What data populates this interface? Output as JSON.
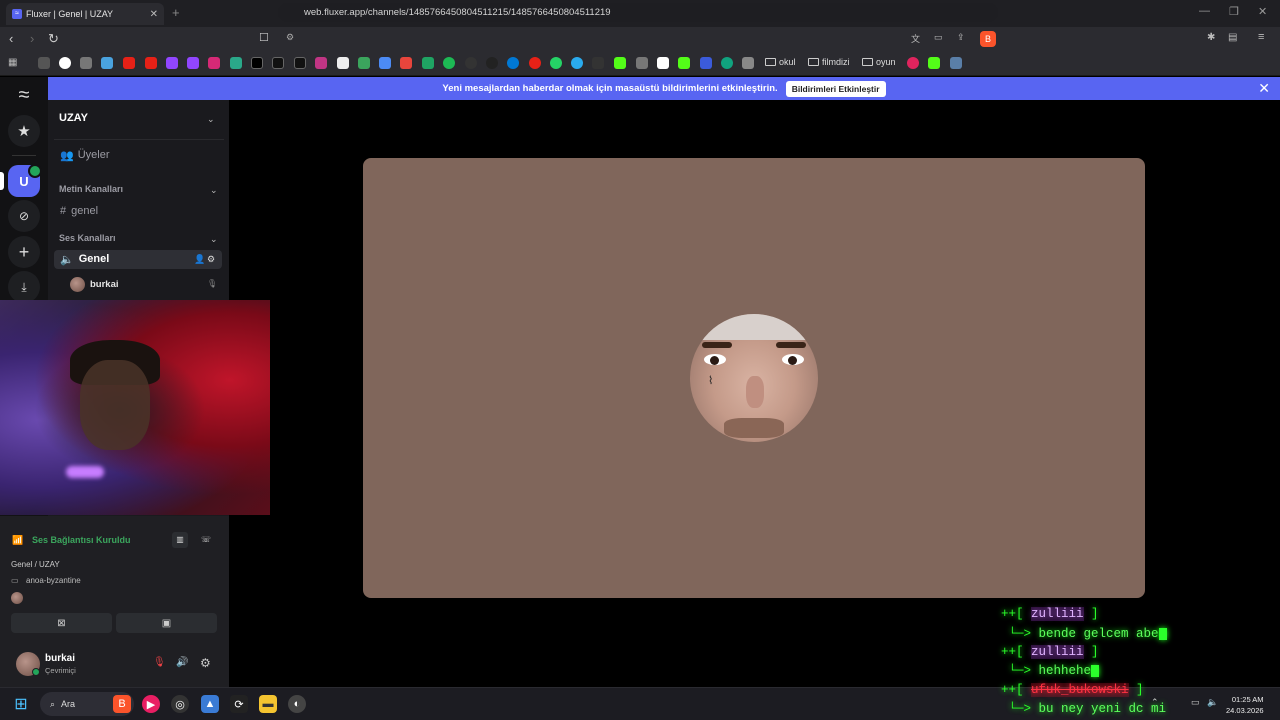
{
  "browser": {
    "tab_title": "Fluxer | Genel | UZAY",
    "url": "web.fluxer.app/channels/1485766450804511215/1485766450804511219",
    "bookmark_folders": [
      "okul",
      "filmdizi",
      "oyun"
    ]
  },
  "banner": {
    "message": "Yeni mesajlardan haberdar olmak için masaüstü bildirimlerini etkinleştirin.",
    "cta_label": "Bildirimleri Etkinleştir"
  },
  "rail": {
    "server_initial": "U"
  },
  "sidebar": {
    "server_name": "UZAY",
    "members_label": "Üyeler",
    "text_category": "Metin Kanalları",
    "text_channel": "genel",
    "voice_category": "Ses Kanalları",
    "voice_channel": "Genel",
    "voice_member": "burkai"
  },
  "voice_panel": {
    "status": "Ses Bağlantısı Kuruldu",
    "channel_path": "Genel / UZAY",
    "activity": "anoa-byzantine"
  },
  "user_panel": {
    "username": "burkai",
    "status": "Çevrimiçi"
  },
  "chat_overlay": [
    {
      "user": "zulliii",
      "message": "bende gelcem abe",
      "style": "purple"
    },
    {
      "user": "zulliii",
      "message": "hehhehe",
      "style": "purple"
    },
    {
      "user": "ufuk_bukowski",
      "message": "bu ney yeni dc mi",
      "style": "red"
    }
  ],
  "taskbar": {
    "search_label": "Ara",
    "time": "01:25 AM",
    "date": "24.03.2026"
  },
  "colors": {
    "accent": "#5865f2",
    "connected": "#3ba55d",
    "video_tile_bg": "#80665b",
    "terminal_green": "#2bff2b"
  }
}
